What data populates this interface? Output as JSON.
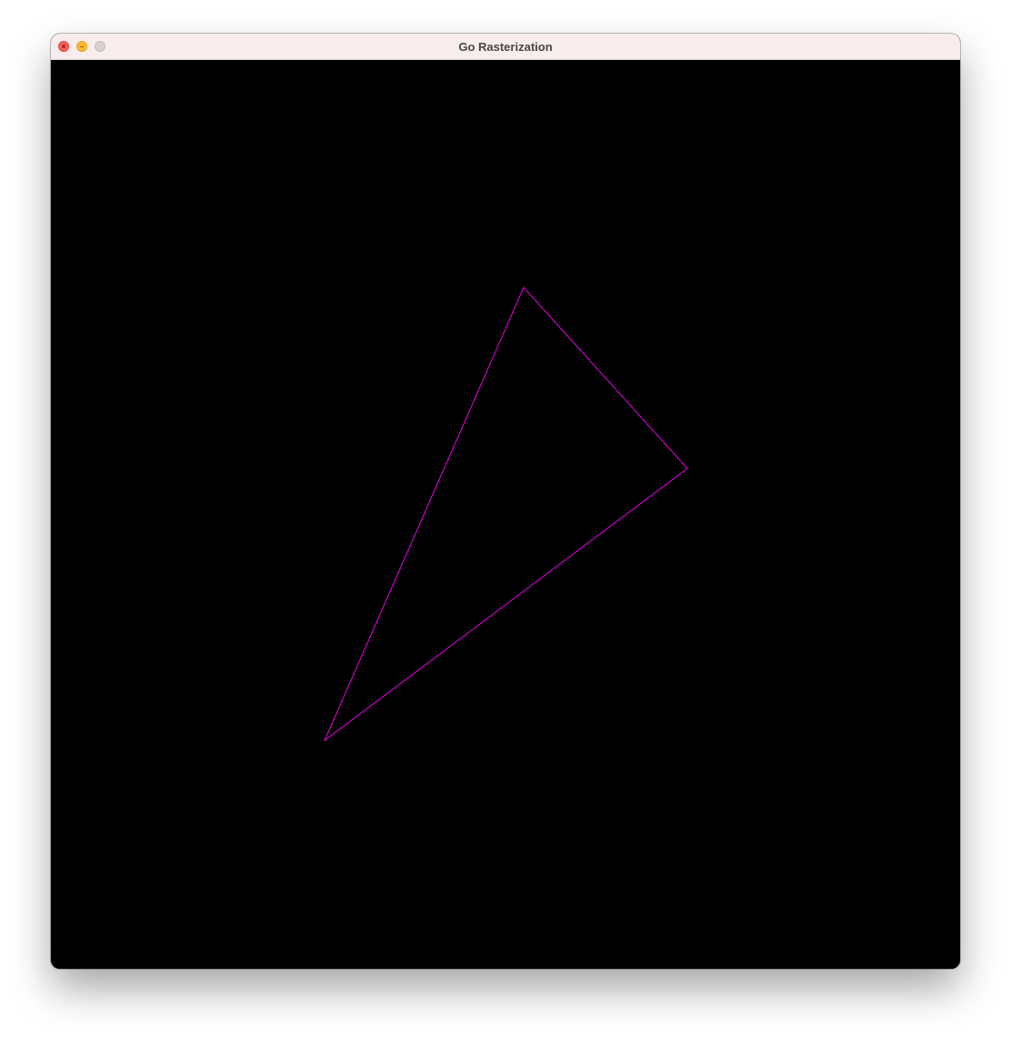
{
  "window": {
    "title": "Go Rasterization",
    "controls": {
      "close_icon": "close-icon",
      "minimize_icon": "minimize-icon",
      "zoom_icon": "zoom-icon"
    }
  },
  "scene": {
    "background_color": "#000000",
    "shape": "triangle",
    "stroke_color": "#e600e6",
    "fill": "none"
  },
  "colors": {
    "titlebar": "#f8eded",
    "close": "#ff5f57",
    "minimize": "#febc2e",
    "zoom_inactive": "#d7d2d2"
  }
}
